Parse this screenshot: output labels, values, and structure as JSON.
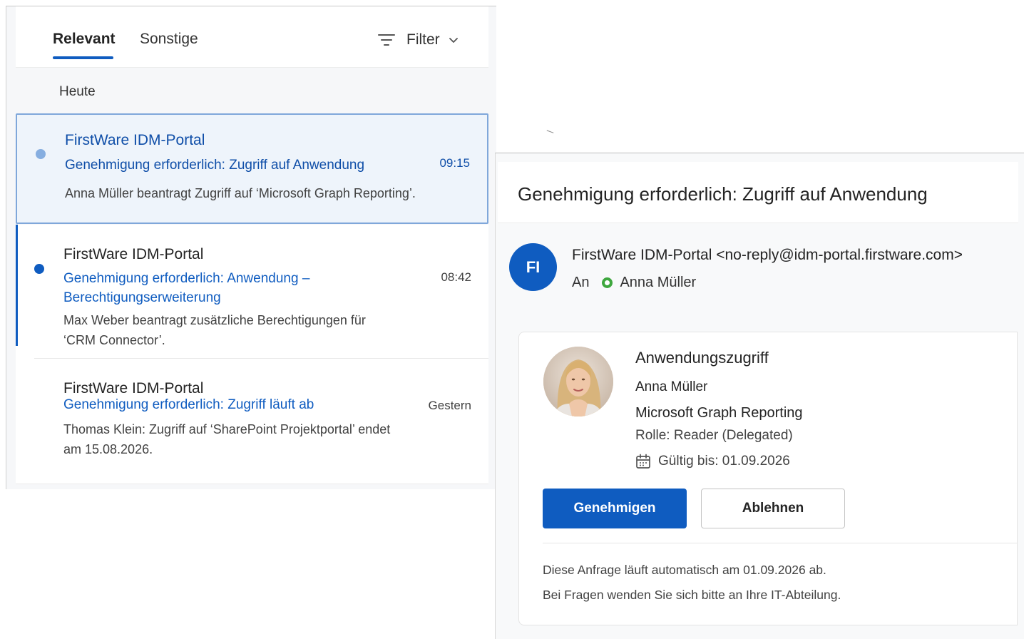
{
  "mail_list": {
    "tabs": [
      {
        "label": "Relevant",
        "active": true
      },
      {
        "label": "Sonstige",
        "active": false
      }
    ],
    "filter_label": "Filter",
    "group_label": "Heute",
    "messages": [
      {
        "sender": "FirstWare IDM-Portal",
        "subject": "Genehmigung erforderlich: Zugriff auf Anwendung",
        "time": "09:15",
        "preview": "Anna Müller beantragt Zugriff auf ‘Microsoft Graph Reporting’.",
        "state": "selected"
      },
      {
        "sender": "FirstWare IDM-Portal",
        "subject": "Genehmigung erforderlich: Anwendung – Berechtigungserweiterung",
        "time": "08:42",
        "preview": "Max Weber beantragt zusätzliche Berechtigungen für ‘CRM Connector’.",
        "state": "unread"
      },
      {
        "sender": "FirstWare IDM-Portal",
        "subject": "Genehmigung erforderlich: Zugriff läuft ab",
        "time": "Gestern",
        "preview": "Thomas Klein: Zugriff auf ‘SharePoint Projektportal’ endet am 15.08.2026.",
        "state": "read"
      }
    ]
  },
  "reading_pane": {
    "subject": "Genehmigung erforderlich: Zugriff auf Anwendung",
    "sender_initials": "FI",
    "from": "FirstWare IDM-Portal <no-reply@idm-portal.firstware.com>",
    "to_label": "An",
    "recipient": "Anna Müller",
    "card": {
      "title": "Anwendungszugriff",
      "user": "Anna Müller",
      "application": "Microsoft Graph Reporting",
      "role": "Rolle: Reader (Delegated)",
      "valid_until": "Gültig bis: 01.09.2026",
      "approve_label": "Genehmigen",
      "reject_label": "Ablehnen",
      "footer_line_1": "Diese Anfrage läuft automatisch am 01.09.2026 ab.",
      "footer_line_2": "Bei Fragen wenden Sie sich bitte an Ihre IT-Abteilung."
    }
  },
  "colors": {
    "accent": "#0f5cc0",
    "selected_background": "#eef4fb",
    "presence_available": "#3ea73e"
  },
  "icons": [
    "filter-icon",
    "chevron-down-icon",
    "calendar-icon",
    "presence-available-icon"
  ]
}
